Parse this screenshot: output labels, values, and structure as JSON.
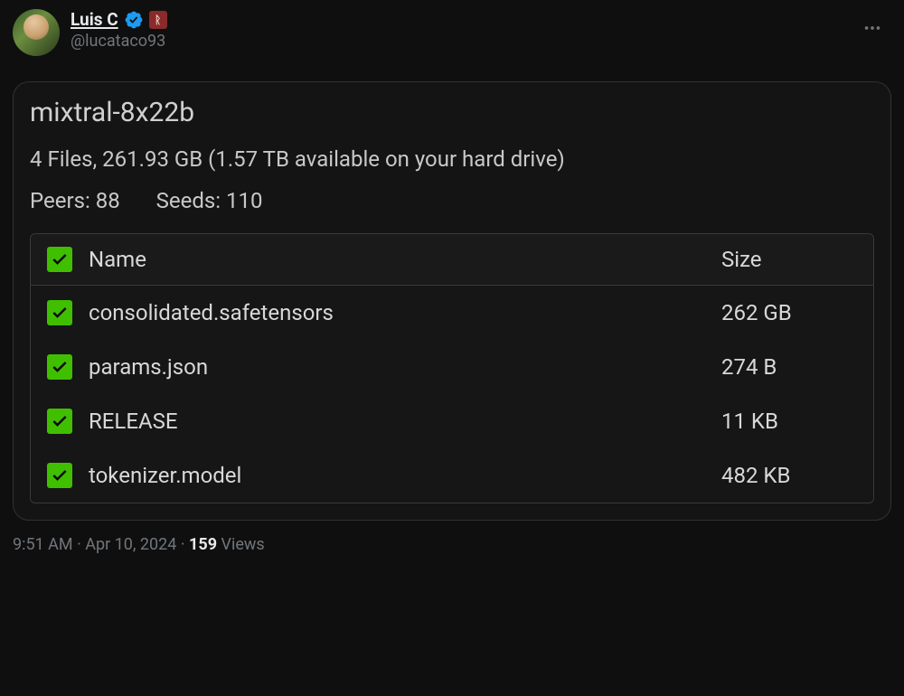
{
  "author": {
    "display_name": "Luis C",
    "handle": "@lucataco93"
  },
  "card": {
    "title": "mixtral-8x22b",
    "summary": "4 Files,  261.93 GB  (1.57 TB available on your hard drive)",
    "peers_label": "Peers:",
    "peers_value": "88",
    "seeds_label": "Seeds:",
    "seeds_value": "110",
    "columns": {
      "name": "Name",
      "size": "Size"
    },
    "files": [
      {
        "name": "consolidated.safetensors",
        "size": "262 GB"
      },
      {
        "name": "params.json",
        "size": "274 B"
      },
      {
        "name": "RELEASE",
        "size": "11 KB"
      },
      {
        "name": "tokenizer.model",
        "size": "482 KB"
      }
    ]
  },
  "footer": {
    "time": "9:51 AM",
    "date": "Apr 10, 2024",
    "views_count": "159",
    "views_label": "Views"
  }
}
